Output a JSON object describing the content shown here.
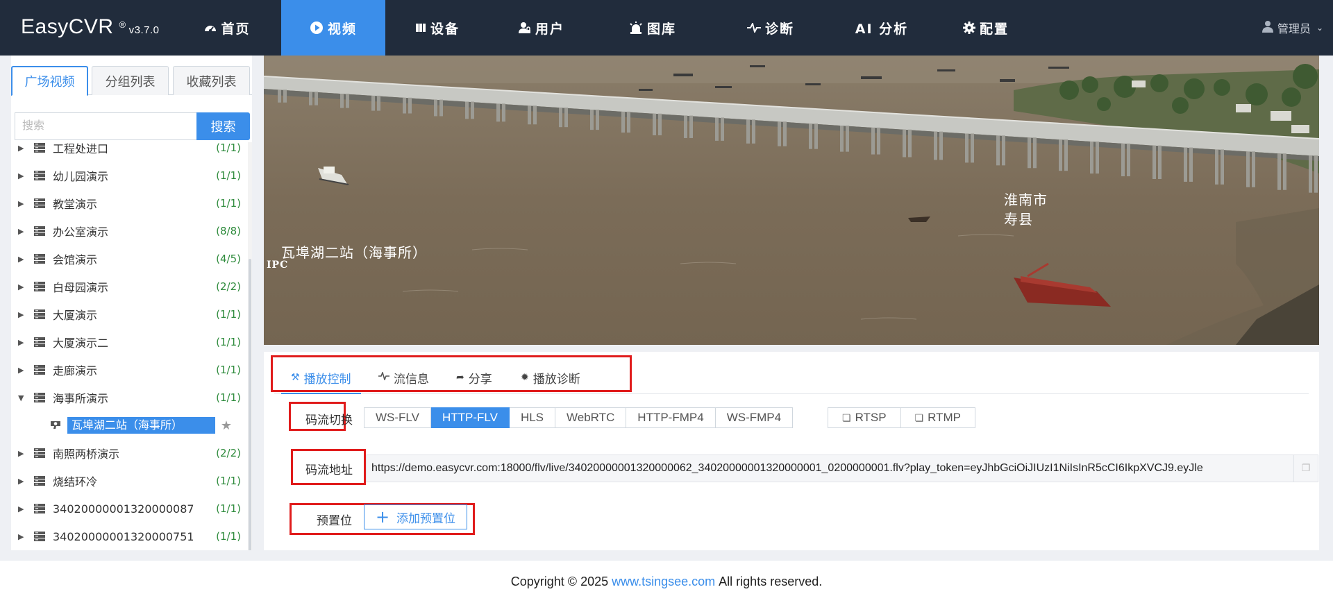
{
  "app": {
    "brand": "EasyCVR",
    "reg_mark": "®",
    "version": "v3.7.0"
  },
  "nav": {
    "items": [
      {
        "label": "首页",
        "icon": "dashboard-icon"
      },
      {
        "label": "视频",
        "icon": "play-circle-icon",
        "active": true
      },
      {
        "label": "设备",
        "icon": "book-icon"
      },
      {
        "label": "用户",
        "icon": "user-lock-icon"
      },
      {
        "label": "图库",
        "icon": "alarm-icon"
      },
      {
        "label": "诊断",
        "icon": "pulse-icon"
      },
      {
        "label": "AI 分析",
        "icon": ""
      },
      {
        "label": "配置",
        "icon": "gear-icon"
      }
    ],
    "user_label": "管理员"
  },
  "sidebar": {
    "tabs": [
      "广场视频",
      "分组列表",
      "收藏列表"
    ],
    "active_tab": 0,
    "search": {
      "placeholder": "搜索",
      "button": "搜索"
    },
    "tree": [
      {
        "label": "工程处进口",
        "count": "(1/1)"
      },
      {
        "label": "幼儿园演示",
        "count": "(1/1)"
      },
      {
        "label": "教堂演示",
        "count": "(1/1)"
      },
      {
        "label": "办公室演示",
        "count": "(8/8)"
      },
      {
        "label": "会馆演示",
        "count": "(4/5)"
      },
      {
        "label": "白母园演示",
        "count": "(2/2)"
      },
      {
        "label": "大厦演示",
        "count": "(1/1)"
      },
      {
        "label": "大厦演示二",
        "count": "(1/1)"
      },
      {
        "label": "走廊演示",
        "count": "(1/1)"
      },
      {
        "label": "海事所演示",
        "count": "(1/1)",
        "expanded": true
      },
      {
        "label": "南照两桥演示",
        "count": "(2/2)"
      },
      {
        "label": "烧结环冷",
        "count": "(1/1)"
      },
      {
        "label": "34020000001320000087",
        "count": "(1/1)"
      },
      {
        "label": "34020000001320000751",
        "count": "(1/1)"
      }
    ],
    "selected_channel": "瓦埠湖二站（海事所）"
  },
  "video": {
    "osd_city": "淮南市",
    "osd_county": "寿县",
    "osd_title": "瓦埠湖二站（海事所）",
    "osd_tag": "IPC"
  },
  "panel": {
    "tabs": [
      {
        "label": "播放控制",
        "icon": "tools-icon"
      },
      {
        "label": "流信息",
        "icon": "pulse-icon"
      },
      {
        "label": "分享",
        "icon": "share-icon"
      },
      {
        "label": "播放诊断",
        "icon": "bug-icon"
      }
    ],
    "active_tab": 0,
    "stream_switch": {
      "label": "码流切换",
      "options": [
        "WS-FLV",
        "HTTP-FLV",
        "HLS",
        "WebRTC",
        "HTTP-FMP4",
        "WS-FMP4"
      ],
      "selected": "HTTP-FLV",
      "extra": [
        "RTSP",
        "RTMP"
      ]
    },
    "stream_url": {
      "label": "码流地址",
      "value": "https://demo.easycvr.com:18000/flv/live/34020000001320000062_34020000001320000001_0200000001.flv?play_token=eyJhbGciOiJIUzI1NiIsInR5cCI6IkpXVCJ9.eyJle"
    },
    "preset": {
      "label": "预置位",
      "button": "添加预置位"
    }
  },
  "footer": {
    "prefix": "Copyright © 2025",
    "link": "www.tsingsee.com",
    "suffix": "All rights reserved."
  },
  "colors": {
    "topbar": "#212c3c",
    "accent": "#3b8eea",
    "highlight_box": "#e01c1c",
    "count_green": "#2e8b3c"
  }
}
